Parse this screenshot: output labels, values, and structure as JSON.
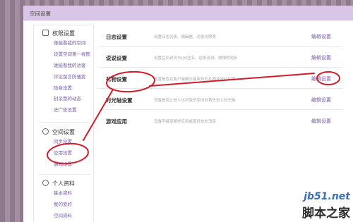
{
  "window": {
    "title": "空间设置"
  },
  "sidebar": {
    "groups": [
      {
        "title": "权限设置",
        "icon": "lock-icon",
        "items": [
          {
            "label": "谁能看我的空间"
          },
          {
            "label": "设置空间第一视图"
          },
          {
            "label": "谁能看我的访客"
          },
          {
            "label": "评论留言防骚扰"
          },
          {
            "label": "隐身设置"
          },
          {
            "label": "封杀我的动态"
          },
          {
            "label": "去广告设置"
          }
        ]
      },
      {
        "title": "空间设置",
        "icon": "shield-icon",
        "items": [
          {
            "label": "同步设置"
          },
          {
            "label": "应用设置"
          },
          {
            "label": "通知设置"
          }
        ]
      },
      {
        "title": "个人资料",
        "icon": "user-icon",
        "items": [
          {
            "label": "基本资料"
          },
          {
            "label": "我的爱好"
          },
          {
            "label": "空间资料"
          }
        ]
      }
    ]
  },
  "settings": {
    "rows": [
      {
        "name": "日志设置",
        "desc": "设置日志列表、编辑器、访客权限等",
        "action": "编辑设置"
      },
      {
        "name": "说说设置",
        "desc": "设置空间说说与QQ签名、朋友说说、微博的同步",
        "action": "编辑设置"
      },
      {
        "name": "礼物设置",
        "desc": "设置是否在客户端展示接收到的礼物及送礼权限",
        "action": "编辑设置"
      },
      {
        "name": "时光轴设置",
        "desc": "设置是否让他人访问我的空间时首先进入时光轴",
        "action": "编辑设置"
      },
      {
        "name": "游戏应用",
        "desc": "设置不接受哪些应用或者好友的消息",
        "action": "编辑设置"
      }
    ]
  },
  "watermark": {
    "line1": "jb51.net",
    "line2": "脚本之家"
  },
  "annotation_color": "#d21c2a"
}
